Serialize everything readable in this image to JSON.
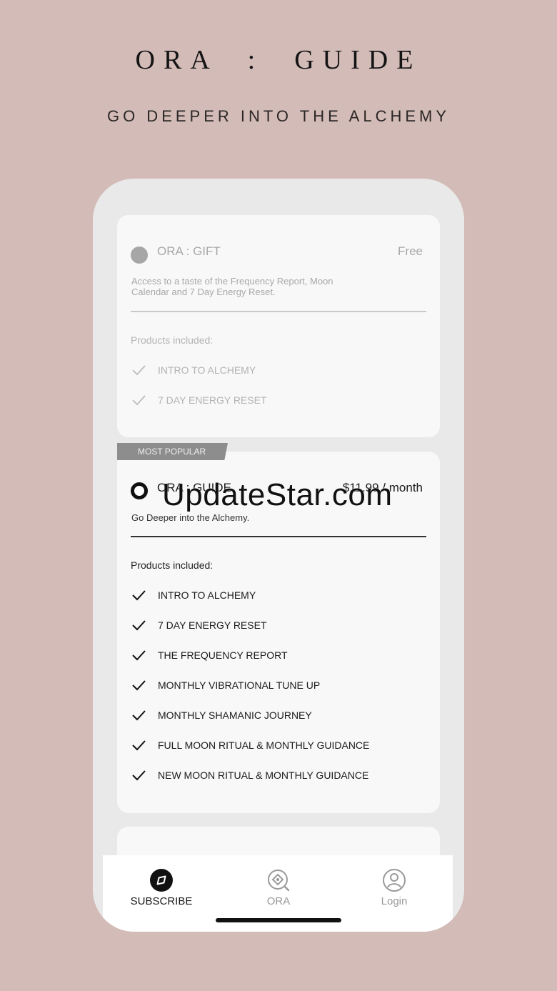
{
  "header": {
    "title": "ORA  :  GUIDE",
    "subtitle": "GO DEEPER INTO THE ALCHEMY"
  },
  "plans": [
    {
      "name": "ORA : GIFT",
      "price": "Free",
      "description": "Access to a taste of the Frequency Report, Moon Calendar and 7 Day Energy Reset.",
      "products_heading": "Products included:",
      "selected": false,
      "items": [
        "INTRO TO ALCHEMY",
        "7 DAY ENERGY RESET"
      ]
    },
    {
      "badge": "MOST POPULAR",
      "name": "ORA : GUIDE",
      "price": "$11.99 / month",
      "description": "Go Deeper into the Alchemy.",
      "products_heading": "Products included:",
      "selected": true,
      "items": [
        "INTRO TO ALCHEMY",
        "7 DAY ENERGY RESET",
        "THE FREQUENCY REPORT",
        "MONTHLY VIBRATIONAL TUNE UP",
        "MONTHLY SHAMANIC JOURNEY",
        "FULL MOON RITUAL & MONTHLY GUIDANCE",
        "NEW MOON RITUAL & MONTHLY GUIDANCE"
      ]
    }
  ],
  "tabbar": {
    "active": "subscribe",
    "tabs": [
      {
        "label": "SUBSCRIBE",
        "icon": "compass-icon"
      },
      {
        "label": "ORA",
        "icon": "diamond-search-icon"
      },
      {
        "label": "Login",
        "icon": "user-icon"
      }
    ]
  },
  "watermark": "UpdateStar.com",
  "colors": {
    "background": "#d3bbb7",
    "card": "#f8f8f8",
    "badge": "#8d8d8d",
    "text_dark": "#1c1c1c",
    "text_muted": "#a8a8a8"
  }
}
